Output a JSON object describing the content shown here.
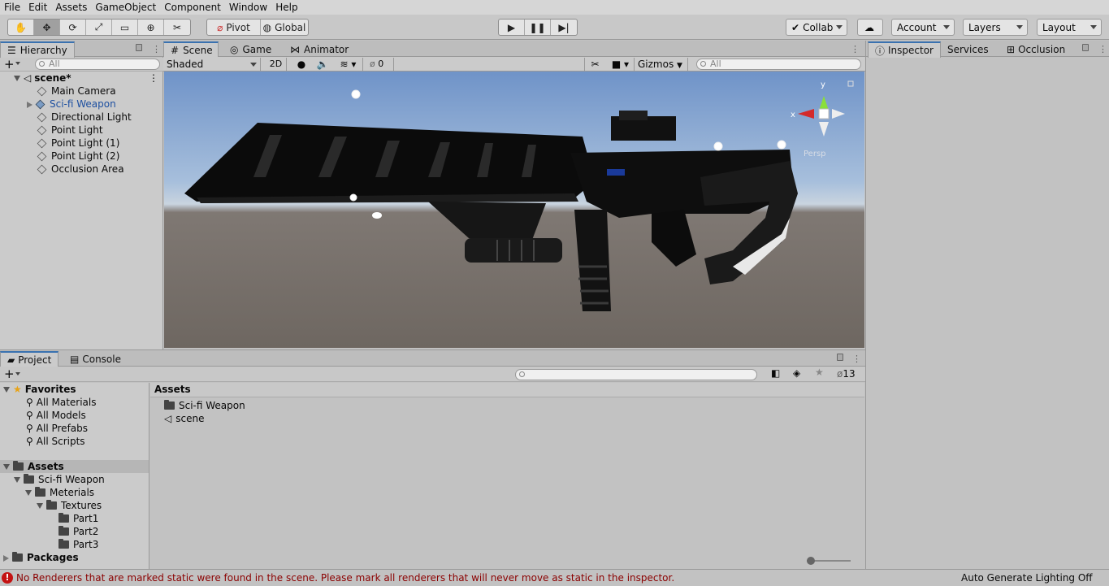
{
  "menu": [
    "File",
    "Edit",
    "Assets",
    "GameObject",
    "Component",
    "Window",
    "Help"
  ],
  "toolbar": {
    "pivot_label": "Pivot",
    "global_label": "Global",
    "collab_label": "Collab",
    "account_label": "Account",
    "layers_label": "Layers",
    "layout_label": "Layout"
  },
  "hierarchy": {
    "tab_label": "Hierarchy",
    "search_placeholder": "All",
    "scene_name": "scene*",
    "items": [
      {
        "label": "Main Camera"
      },
      {
        "label": "Sci-fi Weapon"
      },
      {
        "label": "Directional Light"
      },
      {
        "label": "Point Light"
      },
      {
        "label": "Point Light (1)"
      },
      {
        "label": "Point Light (2)"
      },
      {
        "label": "Occlusion Area"
      }
    ]
  },
  "scene": {
    "tabs": [
      "Scene",
      "Game",
      "Animator"
    ],
    "shading_mode": "Shaded",
    "mode_2d_label": "2D",
    "hidden_count": "0",
    "gizmos_label": "Gizmos",
    "search_placeholder": "All",
    "axis_x": "x",
    "axis_y": "y",
    "persp_label": "Persp"
  },
  "inspector": {
    "tabs": [
      "Inspector",
      "Services",
      "Occlusion"
    ]
  },
  "project": {
    "tabs": [
      "Project",
      "Console"
    ],
    "favorites_label": "Favorites",
    "favorites": [
      "All Materials",
      "All Models",
      "All Prefabs",
      "All Scripts"
    ],
    "assets_label": "Assets",
    "tree": [
      {
        "label": "Sci-fi Weapon"
      },
      {
        "label": "Meterials"
      },
      {
        "label": "Textures"
      },
      {
        "label": "Part1"
      },
      {
        "label": "Part2"
      },
      {
        "label": "Part3"
      }
    ],
    "packages_label": "Packages",
    "breadcrumb": "Assets",
    "contents": [
      {
        "label": "Sci-fi Weapon"
      },
      {
        "label": "scene"
      }
    ],
    "hidden_count": "13"
  },
  "status": {
    "error_message": "No Renderers that are marked static were found in the scene. Please mark all renderers that will never move as static in the inspector.",
    "lighting_label": "Auto Generate Lighting Off",
    "error_color": "#8b0000"
  }
}
